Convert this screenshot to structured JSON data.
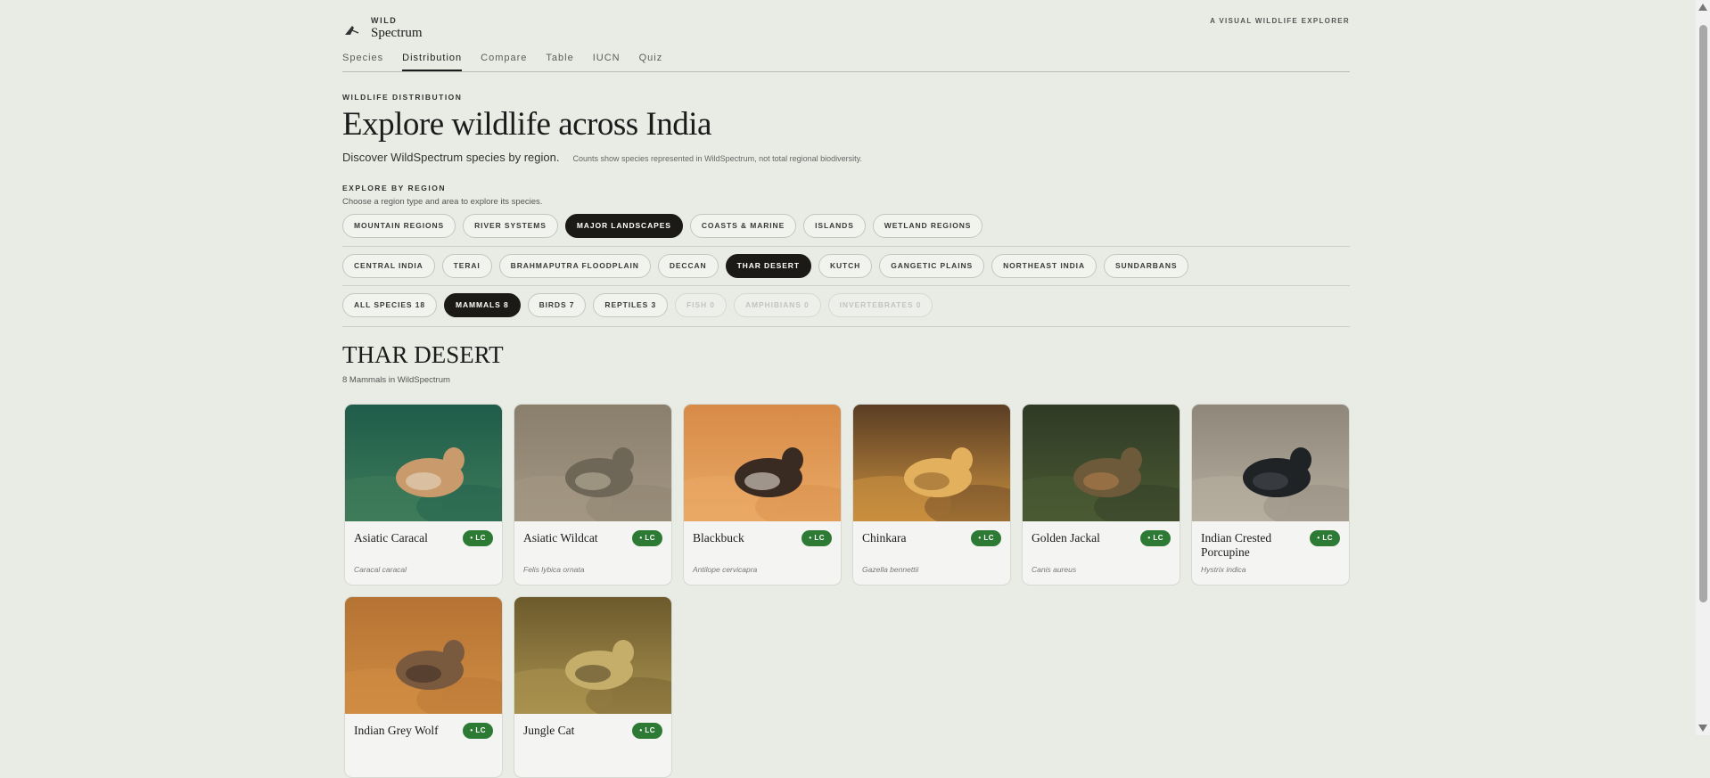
{
  "brand": {
    "small": "WILD",
    "big": "Spectrum",
    "tagline": "A VISUAL WILDLIFE EXPLORER"
  },
  "nav": [
    "Species",
    "Distribution",
    "Compare",
    "Table",
    "IUCN",
    "Quiz"
  ],
  "nav_active": "Distribution",
  "hero": {
    "eyebrow": "WILDLIFE DISTRIBUTION",
    "title": "Explore wildlife across India",
    "lead": "Discover WildSpectrum species by region.",
    "note": "Counts show species represented in WildSpectrum, not total regional biodiversity."
  },
  "explore": {
    "label": "EXPLORE BY REGION",
    "help": "Choose a region type and area to explore its species."
  },
  "region_types": [
    {
      "label": "MOUNTAIN REGIONS",
      "state": "normal"
    },
    {
      "label": "RIVER SYSTEMS",
      "state": "normal"
    },
    {
      "label": "MAJOR LANDSCAPES",
      "state": "active"
    },
    {
      "label": "COASTS & MARINE",
      "state": "normal"
    },
    {
      "label": "ISLANDS",
      "state": "normal"
    },
    {
      "label": "WETLAND REGIONS",
      "state": "normal"
    }
  ],
  "areas": [
    {
      "label": "CENTRAL INDIA",
      "state": "normal"
    },
    {
      "label": "TERAI",
      "state": "normal"
    },
    {
      "label": "BRAHMAPUTRA FLOODPLAIN",
      "state": "normal"
    },
    {
      "label": "DECCAN",
      "state": "normal"
    },
    {
      "label": "THAR DESERT",
      "state": "active"
    },
    {
      "label": "KUTCH",
      "state": "normal"
    },
    {
      "label": "GANGETIC PLAINS",
      "state": "normal"
    },
    {
      "label": "NORTHEAST INDIA",
      "state": "normal"
    },
    {
      "label": "SUNDARBANS",
      "state": "normal"
    }
  ],
  "filters": [
    {
      "label": "ALL SPECIES 18",
      "state": "normal"
    },
    {
      "label": "MAMMALS 8",
      "state": "active"
    },
    {
      "label": "BIRDS 7",
      "state": "normal"
    },
    {
      "label": "REPTILES 3",
      "state": "normal"
    },
    {
      "label": "FISH 0",
      "state": "disabled"
    },
    {
      "label": "AMPHIBIANS 0",
      "state": "disabled"
    },
    {
      "label": "INVERTEBRATES 0",
      "state": "disabled"
    }
  ],
  "region": {
    "title": "THAR DESERT",
    "count": "8 Mammals in WildSpectrum"
  },
  "species": [
    {
      "name": "Asiatic Caracal",
      "sci": "Caracal caracal",
      "status": "• LC",
      "palette": [
        "#1f5c4a",
        "#3e7c5a",
        "#c99a6b",
        "#eadfce"
      ]
    },
    {
      "name": "Asiatic Wildcat",
      "sci": "Felis lybica ornata",
      "status": "• LC",
      "palette": [
        "#8a7f6c",
        "#a39784",
        "#6e6656",
        "#c2b8a5"
      ]
    },
    {
      "name": "Blackbuck",
      "sci": "Antilope cervicapra",
      "status": "• LC",
      "palette": [
        "#d88b48",
        "#e9a965",
        "#3a2b22",
        "#f4ede2"
      ]
    },
    {
      "name": "Chinkara",
      "sci": "Gazella bennettii",
      "status": "• LC",
      "palette": [
        "#5a3d24",
        "#c9903f",
        "#e3b15e",
        "#8a5b2a"
      ]
    },
    {
      "name": "Golden Jackal",
      "sci": "Canis aureus",
      "status": "• LC",
      "palette": [
        "#2f3a25",
        "#4a5a33",
        "#6d5a3a",
        "#b8824d"
      ]
    },
    {
      "name": "Indian Crested Porcupine",
      "sci": "Hystrix indica",
      "status": "• LC",
      "palette": [
        "#8e877a",
        "#b6ae9f",
        "#1f2326",
        "#4a4f52"
      ]
    },
    {
      "name": "Indian Grey Wolf",
      "sci": "",
      "status": "• LC",
      "palette": [
        "#b57334",
        "#d08c42",
        "#7a5a3e",
        "#3b2c22"
      ]
    },
    {
      "name": "Jungle Cat",
      "sci": "",
      "status": "• LC",
      "palette": [
        "#6d5a2c",
        "#a8914f",
        "#c5ad6a",
        "#4a3d1f"
      ]
    }
  ]
}
